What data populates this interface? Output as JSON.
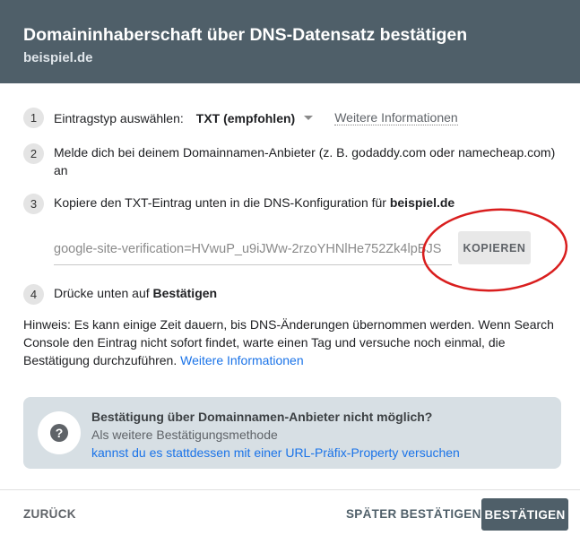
{
  "header": {
    "title": "Domaininhaberschaft über DNS-Datensatz bestätigen",
    "subtitle": "beispiel.de"
  },
  "steps": [
    {
      "number": "1",
      "text": "Eintragstyp auswählen:",
      "select_value": "TXT (empfohlen)",
      "link": "Weitere Informationen"
    },
    {
      "number": "2",
      "text": "Melde dich bei deinem Domainnamen-Anbieter (z. B. godaddy.com oder namecheap.com) an"
    },
    {
      "number": "3",
      "text": "Kopiere den TXT-Eintrag unten in die DNS-Konfiguration für ",
      "domain": "beispiel.de"
    },
    {
      "number": "4",
      "text": "Drücke unten auf ",
      "emphasis": "Bestätigen"
    }
  ],
  "txt_record": {
    "value": "google-site-verification=HVwuP_u9iJWw-2rzoYHNlHe752Zk4lpBJS",
    "copy_label": "KOPIEREN"
  },
  "hint": {
    "text": "Hinweis: Es kann einige Zeit dauern, bis DNS-Änderungen übernommen werden. Wenn Search Console den Eintrag nicht sofort findet, warte einen Tag und versuche noch einmal, die Bestätigung durchzuführen.",
    "link": "Weitere Informationen"
  },
  "alternative": {
    "icon": "question-icon",
    "title": "Bestätigung über Domainnamen-Anbieter nicht möglich?",
    "subtitle": "Als weitere Bestätigungsmethode",
    "link": "kannst du es stattdessen mit einer URL-Präfix-Property versuchen"
  },
  "footer": {
    "back_label": "ZURÜCK",
    "later_label": "SPÄTER BESTÄTIGEN",
    "confirm_label": "BESTÄTIGEN"
  },
  "colors": {
    "header_bg": "#4f5f69",
    "link_blue": "#1a73e8",
    "highlight_ellipse": "#d91e1e"
  }
}
